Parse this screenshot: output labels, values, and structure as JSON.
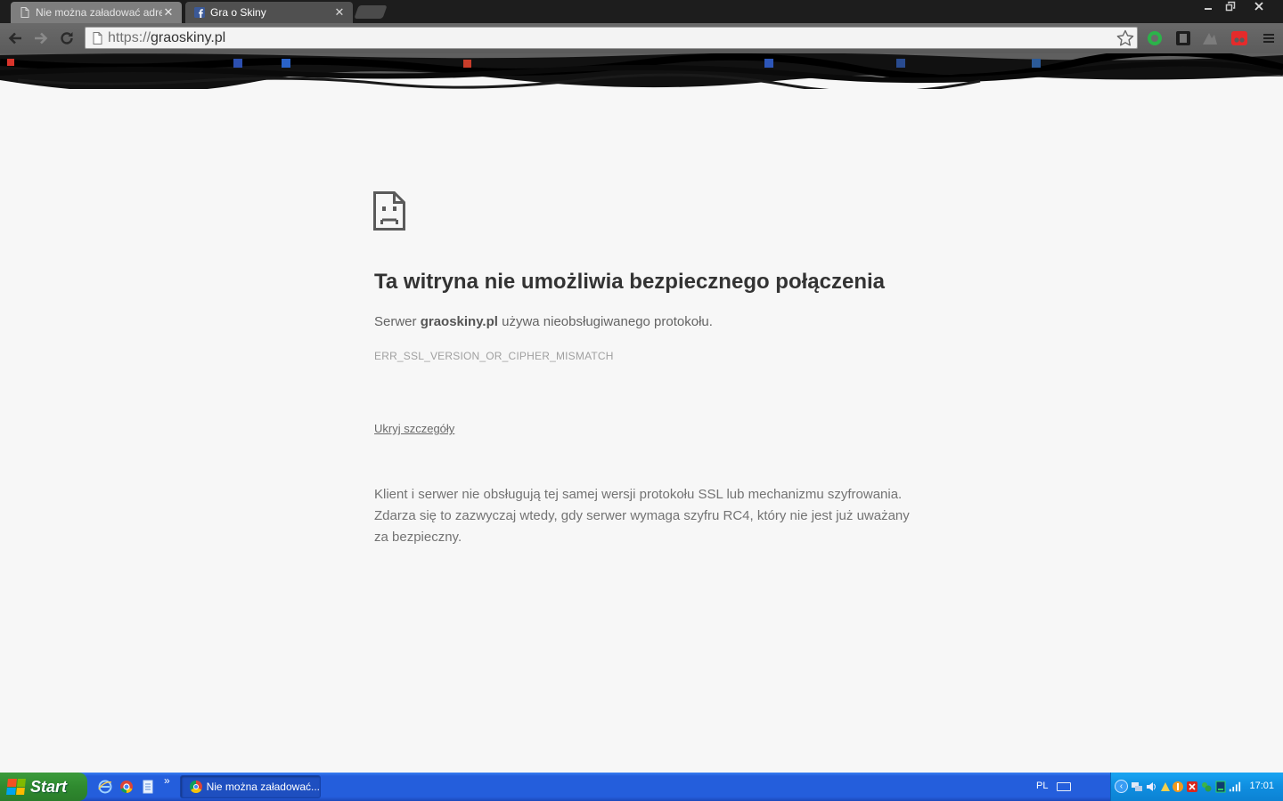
{
  "browser": {
    "tabs": [
      {
        "label": "Nie można załadować adresu",
        "active": true,
        "icon": "document-icon"
      },
      {
        "label": "Gra o Skiny",
        "active": false,
        "icon": "facebook-icon"
      }
    ],
    "address": {
      "scheme": "https://",
      "host": "graoskiny.pl"
    }
  },
  "error_page": {
    "title": "Ta witryna nie umożliwia bezpiecznego połączenia",
    "summary_prefix": "Serwer ",
    "summary_host": "graoskiny.pl",
    "summary_suffix": " używa nieobsługiwanego protokołu.",
    "error_code": "ERR_SSL_VERSION_OR_CIPHER_MISMATCH",
    "details_link": "Ukryj szczegóły",
    "explanation": "Klient i serwer nie obsługują tej samej wersji protokołu SSL lub mechanizmu szyfrowania. Zdarza się to zazwyczaj wtedy, gdy serwer wymaga szyfru RC4, który nie jest już uważany za bezpieczny."
  },
  "taskbar": {
    "start_label": "Start",
    "task_label": "Nie można załadować...",
    "language": "PL",
    "clock": "17:01"
  },
  "colors": {
    "taskbar_blue": "#245edc",
    "start_green": "#2f8a2f",
    "page_background": "#f7f7f7"
  }
}
